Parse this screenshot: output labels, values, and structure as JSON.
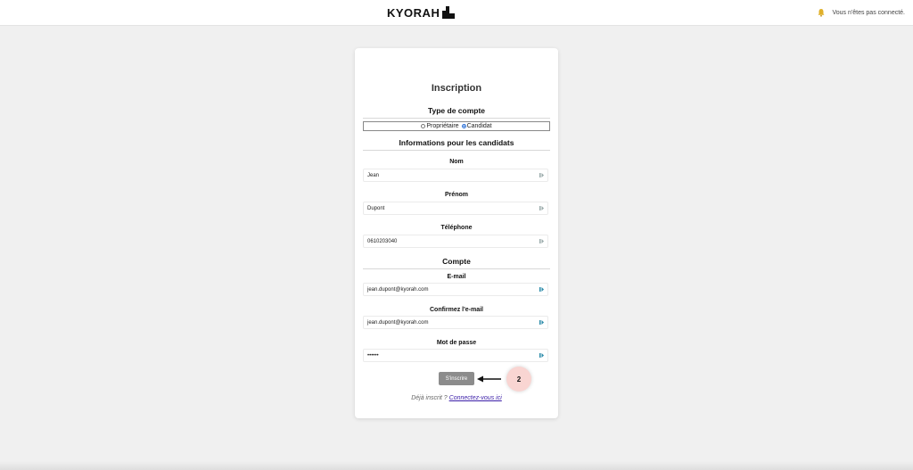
{
  "header": {
    "logo_text": "KYORAH",
    "status_text": "Vous n'êtes pas connecté."
  },
  "form": {
    "title": "Inscription",
    "account_type": {
      "section_title": "Type de compte",
      "options": [
        {
          "label": "Propriétaire",
          "checked": false
        },
        {
          "label": "Candidat",
          "checked": true
        }
      ]
    },
    "candidate_section_title": "Informations pour les candidats",
    "fields": {
      "nom": {
        "label": "Nom",
        "value": "Jean"
      },
      "prenom": {
        "label": "Prénom",
        "value": "Dupont"
      },
      "telephone": {
        "label": "Téléphone",
        "value": "0610203040"
      }
    },
    "account_section_title": "Compte",
    "account_fields": {
      "email": {
        "label": "E-mail",
        "value": "jean.dupont@kyorah.com"
      },
      "email_confirm": {
        "label": "Confirmez l'e-mail",
        "value": "jean.dupont@kyorah.com"
      },
      "password": {
        "label": "Mot de passe",
        "value": "••••••"
      }
    },
    "submit_label": "S'inscrire",
    "login_prompt": "Déjà inscrit ?",
    "login_link": "Connectez-vous ici"
  },
  "annotation": {
    "step_number": "2"
  },
  "colors": {
    "submit_bg": "#8c8c8c",
    "link": "#3b1ea8",
    "badge_bg": "#f9d5d2",
    "radio_checked": "#2a6fd6"
  }
}
